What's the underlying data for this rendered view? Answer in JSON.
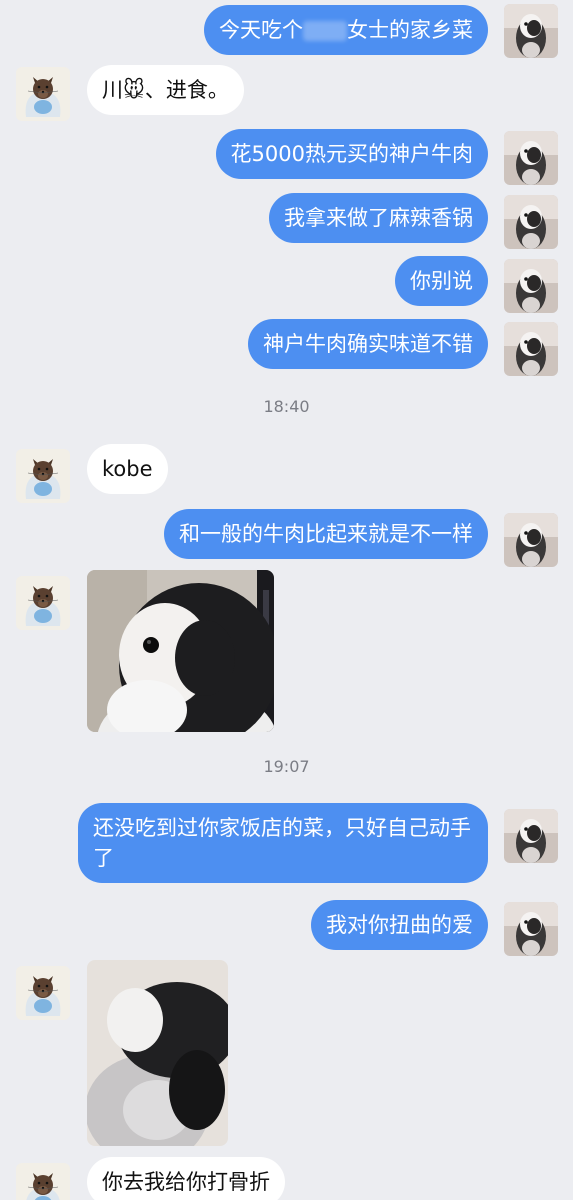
{
  "messages": [
    {
      "text_before": "今天吃个",
      "text_after": "女士的家乡菜"
    },
    {
      "text": "川🐭、进食。"
    },
    {
      "text": "花5000热元买的神户牛肉"
    },
    {
      "text": "我拿来做了麻辣香锅"
    },
    {
      "text": "你别说"
    },
    {
      "text": "神户牛肉确实味道不错"
    },
    {
      "text": "kobe"
    },
    {
      "text": "和一般的牛肉比起来就是不一样"
    },
    {
      "text": "还没吃到过你家饭店的菜，只好自己动手了"
    },
    {
      "text": "我对你扭曲的爱"
    },
    {
      "text": "你去我给你打骨折"
    }
  ],
  "timestamps": [
    "18:40",
    "19:07"
  ],
  "colors": {
    "background": "#ecedf1",
    "outgoing_bubble": "#4d8ff1",
    "incoming_bubble": "#ffffff",
    "timestamp_text": "#7b7d85"
  },
  "icons": {
    "self_avatar": "penguin-plush-avatar",
    "friend_avatar": "squirrel-avatar"
  }
}
